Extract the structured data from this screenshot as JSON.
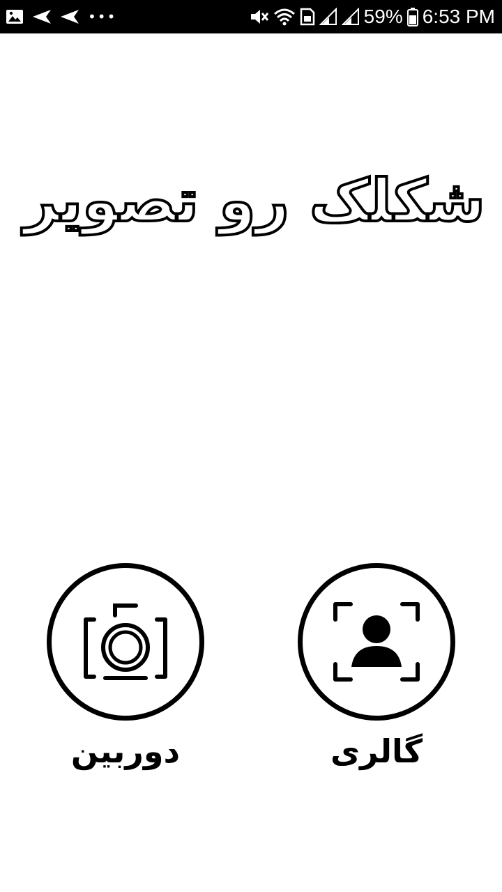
{
  "status_bar": {
    "battery": "59%",
    "time": "6:53 PM",
    "icons_left": [
      "image-icon",
      "send-icon",
      "send-icon",
      "more-icon"
    ],
    "icons_right": [
      "mute-icon",
      "wifi-icon",
      "sim-icon",
      "signal-icon",
      "signal-icon",
      "battery-icon"
    ]
  },
  "logo": {
    "title": "شکلک رو تصویر"
  },
  "actions": {
    "camera": {
      "label": "دوربین",
      "icon": "camera-icon"
    },
    "gallery": {
      "label": "گالری",
      "icon": "gallery-portrait-icon"
    }
  },
  "colors": {
    "background": "#ffffff",
    "foreground": "#000000",
    "status_bar": "#000000"
  }
}
